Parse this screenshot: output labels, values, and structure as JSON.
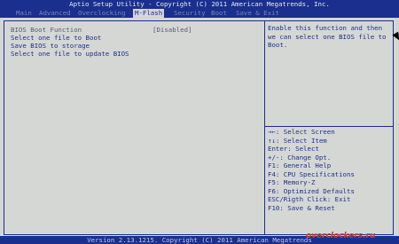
{
  "title": "Aptio Setup Utility - Copyright (C) 2011 American Megatrends, Inc.",
  "menu": [
    "Main",
    "Advanced",
    "Overclocking",
    "M-Flash",
    "Security",
    "Boot",
    "Save & Exit"
  ],
  "active_menu": "M-Flash",
  "items": {
    "bios_boot_function": {
      "label": "BIOS Boot Function",
      "value": "[Disabled]"
    },
    "select_file_boot": "Select one file to Boot",
    "save_bios": "Save BIOS to storage",
    "select_file_update": "Select one file to update BIOS"
  },
  "help": {
    "description": "Enable this function and then we can select one BIOS file to Boot.",
    "keys": [
      "→←: Select Screen",
      "↑↓: Select Item",
      "Enter: Select",
      "+/-: Change Opt.",
      "F1: General Help",
      "F4: CPU Specifications",
      "F5: Memory-Z",
      "F6: Optimized Defaults",
      "ESC/Rigth Click: Exit",
      "F10: Save & Reset"
    ]
  },
  "footer": "Version 2.13.1215. Copyright (C) 2011 American Megatrends",
  "watermark": "overclockers.ru",
  "colors": {
    "frame": "#1a2f8e",
    "panel": "#d5d7d5",
    "accent": "#e03a1a"
  }
}
